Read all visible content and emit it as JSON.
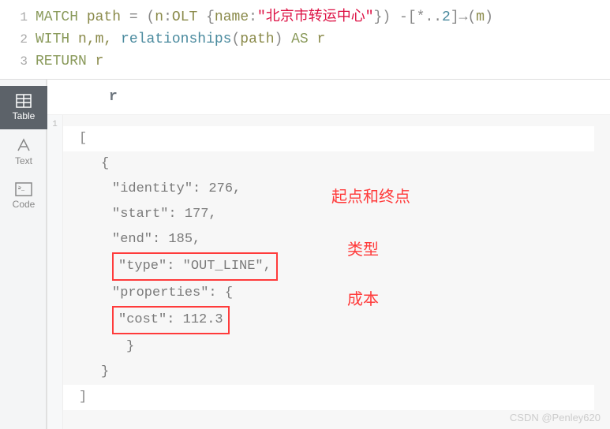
{
  "editor": {
    "lines": [
      "1",
      "2",
      "3"
    ],
    "line1": {
      "match": "MATCH",
      "path": "path",
      "eq": " = ",
      "lp": "(",
      "n": "n",
      "colon": ":",
      "label": "OLT",
      "sp": " ",
      "lb": "{",
      "name_key": "name",
      "col2": ":",
      "str": "\"北京市转运中心\"",
      "rb": "}",
      "rp": ")",
      "sp2": " ",
      "dash": "-",
      "lbr": "[",
      "star": "*",
      "dd": "..",
      "two": "2",
      "rbr": "]",
      "arrow": "→",
      "lp2": "(",
      "m": "m",
      "rp2": ")"
    },
    "line2": {
      "with": "WITH",
      "args": "n,m, ",
      "fn": "relationships",
      "lp": "(",
      "arg": "path",
      "rp": ")",
      "as": " AS ",
      "r": "r"
    },
    "line3": {
      "return": "RETURN",
      "sp": " ",
      "r": "r"
    }
  },
  "sidebar": {
    "table": "Table",
    "text": "Text",
    "code": "Code"
  },
  "results": {
    "header": "r",
    "row_num": "1",
    "open_bracket": "[",
    "open_brace": "{",
    "identity_key": "″identity″",
    "identity_val": ": 276,",
    "start_key": "″start″",
    "start_val": ": 177,",
    "end_key": "″end″",
    "end_val": ": 185,",
    "type_kv": "″type″: ″OUT_LINE″,",
    "props_key": "″properties″",
    "props_val": ": {",
    "cost_kv": "″cost″: 112.3",
    "close_brace_inner": "}",
    "close_brace": "}",
    "close_bracket": "]"
  },
  "annotations": {
    "a1": "起点和终点",
    "a2": "类型",
    "a3": "成本"
  },
  "watermark": "CSDN @Penley620"
}
